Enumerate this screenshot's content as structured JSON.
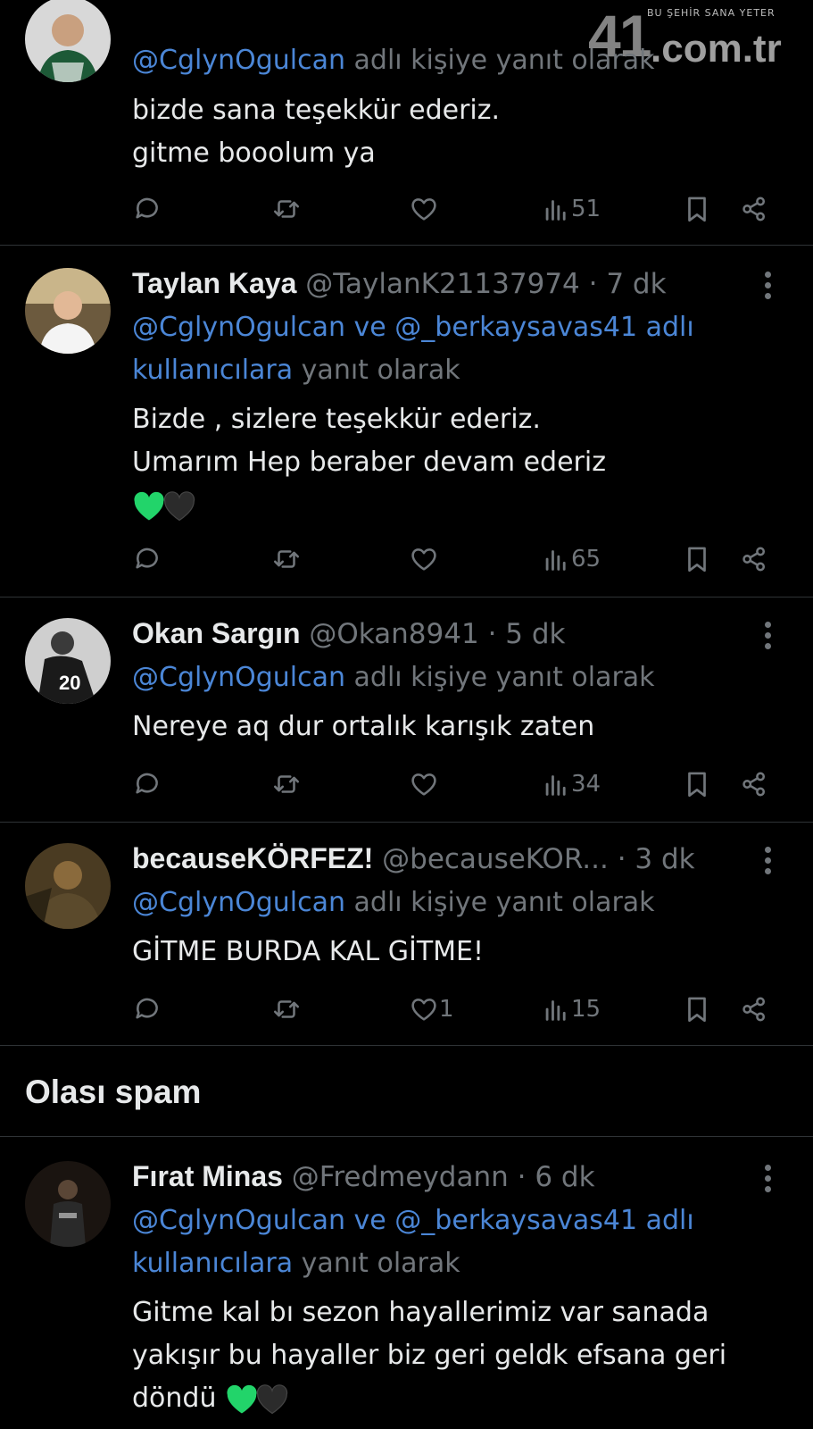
{
  "watermark": {
    "number": "41",
    "domain": ".com.tr",
    "slogan": "BU ŞEHİR SANA YETER"
  },
  "tweets": [
    {
      "reply_prefix": "@CglynOgulcan",
      "reply_suffix": " adlı kişiye yanıt olarak",
      "lines": [
        "bizde sana teşekkür ederiz.",
        "gitme booolum ya"
      ],
      "views": "51",
      "likes": ""
    },
    {
      "name": "Taylan Kaya",
      "handle": "@TaylanK21137974",
      "time": "7 dk",
      "reply_line1_mentions": "@CglynOgulcan ve @_berkaysavas41 adlı",
      "reply_line2_mention": "kullanıcılara",
      "reply_line2_suffix": " yanıt olarak",
      "lines": [
        "Bizde , sizlere teşekkür ederiz.",
        "Umarım Hep beraber devam ederiz"
      ],
      "hearts": [
        "green-heart-icon",
        "black-heart-icon"
      ],
      "views": "65",
      "likes": ""
    },
    {
      "name": "Okan Sargın",
      "handle": "@Okan8941",
      "time": "5 dk",
      "reply_prefix": "@CglynOgulcan",
      "reply_suffix": " adlı kişiye yanıt olarak",
      "lines": [
        "Nereye aq dur ortalık karışık zaten"
      ],
      "views": "34",
      "likes": ""
    },
    {
      "name": "becauseKÖRFEZ!",
      "handle": "@becauseKOR...",
      "time": "3 dk",
      "reply_prefix": "@CglynOgulcan",
      "reply_suffix": " adlı kişiye yanıt olarak",
      "lines": [
        "GİTME BURDA KAL GİTME!"
      ],
      "views": "15",
      "likes": "1"
    },
    {
      "name": "Fırat Minas",
      "handle": "@Fredmeydann",
      "time": "6 dk",
      "reply_line1_mentions": "@CglynOgulcan ve @_berkaysavas41 adlı",
      "reply_line2_mention": "kullanıcılara",
      "reply_line2_suffix": " yanıt olarak",
      "lines": [
        "Gitme kal bı sezon  hayallerimiz var sanada",
        "yakışır bu hayaller biz geri geldk efsana geri",
        "döndü"
      ],
      "hearts": [
        "green-heart-icon",
        "black-heart-icon"
      ]
    }
  ],
  "spam_section": {
    "title": "Olası spam"
  },
  "colors": {
    "background": "#000000",
    "text": "#e7e9ea",
    "muted": "#71767b",
    "mention": "#4b86d6",
    "divider": "#2f3336",
    "green_heart": "#22d46a"
  }
}
